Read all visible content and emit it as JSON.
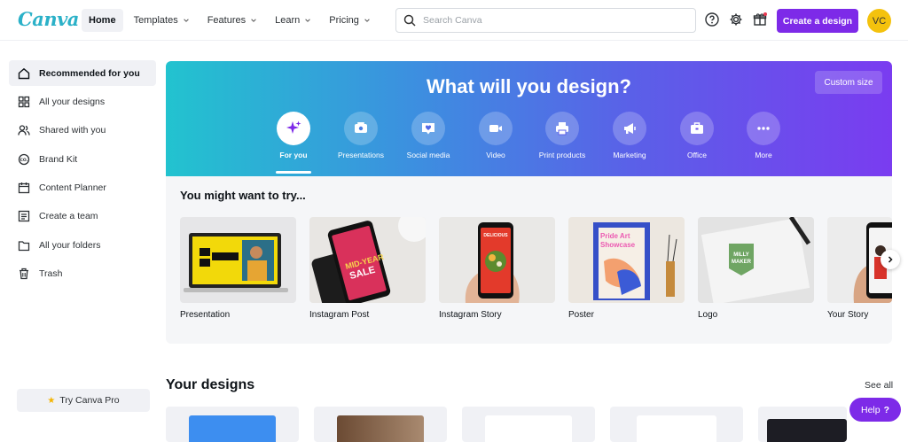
{
  "brand": {
    "name": "Canva",
    "color": "#2bb1c8",
    "accent": "#7d2ae8"
  },
  "nav": {
    "items": [
      {
        "label": "Home",
        "active": true,
        "dropdown": false
      },
      {
        "label": "Templates",
        "active": false,
        "dropdown": true
      },
      {
        "label": "Features",
        "active": false,
        "dropdown": true
      },
      {
        "label": "Learn",
        "active": false,
        "dropdown": true
      },
      {
        "label": "Pricing",
        "active": false,
        "dropdown": true
      }
    ]
  },
  "search": {
    "placeholder": "Search Canva",
    "value": ""
  },
  "header": {
    "icons": [
      "help-circle-icon",
      "gear-icon",
      "gift-icon"
    ],
    "create_label": "Create a design",
    "avatar_initials": "VC",
    "avatar_color": "#f4c20d"
  },
  "sidebar": {
    "items": [
      {
        "label": "Recommended for you",
        "icon": "home-icon",
        "active": true
      },
      {
        "label": "All your designs",
        "icon": "grid-icon",
        "active": false
      },
      {
        "label": "Shared with you",
        "icon": "users-icon",
        "active": false
      },
      {
        "label": "Brand Kit",
        "icon": "brand-kit-icon",
        "active": false
      },
      {
        "label": "Content Planner",
        "icon": "calendar-icon",
        "active": false
      },
      {
        "label": "Create a team",
        "icon": "team-icon",
        "active": false
      },
      {
        "label": "All your folders",
        "icon": "folder-icon",
        "active": false
      },
      {
        "label": "Trash",
        "icon": "trash-icon",
        "active": false
      }
    ],
    "try_pro_label": "Try Canva Pro"
  },
  "hero": {
    "title": "What will you design?",
    "custom_size_label": "Custom size",
    "categories": [
      {
        "label": "For you",
        "icon": "sparkle-icon",
        "active": true
      },
      {
        "label": "Presentations",
        "icon": "presentation-icon",
        "active": false
      },
      {
        "label": "Social media",
        "icon": "heart-icon",
        "active": false
      },
      {
        "label": "Video",
        "icon": "video-icon",
        "active": false
      },
      {
        "label": "Print products",
        "icon": "printer-icon",
        "active": false
      },
      {
        "label": "Marketing",
        "icon": "megaphone-icon",
        "active": false
      },
      {
        "label": "Office",
        "icon": "briefcase-icon",
        "active": false
      },
      {
        "label": "More",
        "icon": "more-icon",
        "active": false
      }
    ]
  },
  "suggestions": {
    "title": "You might want to try...",
    "items": [
      {
        "label": "Presentation"
      },
      {
        "label": "Instagram Post",
        "thumb_text": [
          "MID-YEAR",
          "SALE"
        ]
      },
      {
        "label": "Instagram Story",
        "thumb_text": [
          "DELICIOUS"
        ]
      },
      {
        "label": "Poster",
        "thumb_text": [
          "Pride Art",
          "Showcase"
        ]
      },
      {
        "label": "Logo",
        "thumb_text": [
          "MILLY",
          "MAKER"
        ]
      },
      {
        "label": "Your Story"
      }
    ]
  },
  "designs": {
    "title": "Your designs",
    "see_all_label": "See all"
  },
  "help": {
    "label": "Help",
    "symbol": "?"
  }
}
